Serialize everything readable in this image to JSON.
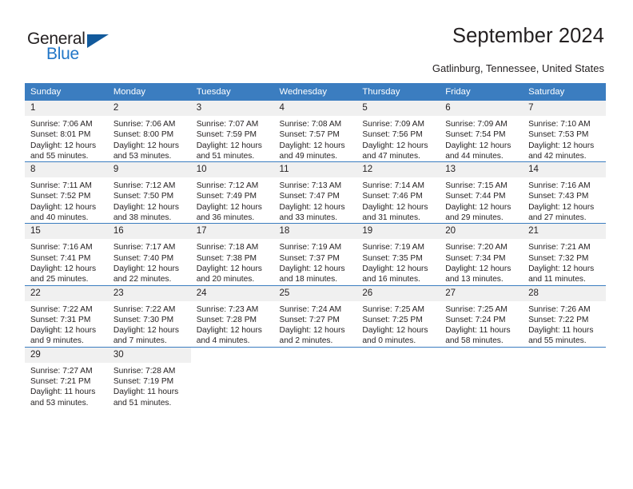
{
  "brand": {
    "name_dark": "General",
    "name_light": "Blue",
    "logo_icon": "triangle-logo-icon",
    "accent_color": "#125a9c",
    "light_accent_color": "#2176c7"
  },
  "header": {
    "title": "September 2024",
    "location": "Gatlinburg, Tennessee, United States"
  },
  "calendar": {
    "header_bg": "#3b7dc0",
    "daynum_bg": "#f0f0f0",
    "weekday_headers": [
      "Sunday",
      "Monday",
      "Tuesday",
      "Wednesday",
      "Thursday",
      "Friday",
      "Saturday"
    ],
    "weeks": [
      [
        {
          "day": "1",
          "sunrise": "Sunrise: 7:06 AM",
          "sunset": "Sunset: 8:01 PM",
          "daylight_1": "Daylight: 12 hours",
          "daylight_2": "and 55 minutes."
        },
        {
          "day": "2",
          "sunrise": "Sunrise: 7:06 AM",
          "sunset": "Sunset: 8:00 PM",
          "daylight_1": "Daylight: 12 hours",
          "daylight_2": "and 53 minutes."
        },
        {
          "day": "3",
          "sunrise": "Sunrise: 7:07 AM",
          "sunset": "Sunset: 7:59 PM",
          "daylight_1": "Daylight: 12 hours",
          "daylight_2": "and 51 minutes."
        },
        {
          "day": "4",
          "sunrise": "Sunrise: 7:08 AM",
          "sunset": "Sunset: 7:57 PM",
          "daylight_1": "Daylight: 12 hours",
          "daylight_2": "and 49 minutes."
        },
        {
          "day": "5",
          "sunrise": "Sunrise: 7:09 AM",
          "sunset": "Sunset: 7:56 PM",
          "daylight_1": "Daylight: 12 hours",
          "daylight_2": "and 47 minutes."
        },
        {
          "day": "6",
          "sunrise": "Sunrise: 7:09 AM",
          "sunset": "Sunset: 7:54 PM",
          "daylight_1": "Daylight: 12 hours",
          "daylight_2": "and 44 minutes."
        },
        {
          "day": "7",
          "sunrise": "Sunrise: 7:10 AM",
          "sunset": "Sunset: 7:53 PM",
          "daylight_1": "Daylight: 12 hours",
          "daylight_2": "and 42 minutes."
        }
      ],
      [
        {
          "day": "8",
          "sunrise": "Sunrise: 7:11 AM",
          "sunset": "Sunset: 7:52 PM",
          "daylight_1": "Daylight: 12 hours",
          "daylight_2": "and 40 minutes."
        },
        {
          "day": "9",
          "sunrise": "Sunrise: 7:12 AM",
          "sunset": "Sunset: 7:50 PM",
          "daylight_1": "Daylight: 12 hours",
          "daylight_2": "and 38 minutes."
        },
        {
          "day": "10",
          "sunrise": "Sunrise: 7:12 AM",
          "sunset": "Sunset: 7:49 PM",
          "daylight_1": "Daylight: 12 hours",
          "daylight_2": "and 36 minutes."
        },
        {
          "day": "11",
          "sunrise": "Sunrise: 7:13 AM",
          "sunset": "Sunset: 7:47 PM",
          "daylight_1": "Daylight: 12 hours",
          "daylight_2": "and 33 minutes."
        },
        {
          "day": "12",
          "sunrise": "Sunrise: 7:14 AM",
          "sunset": "Sunset: 7:46 PM",
          "daylight_1": "Daylight: 12 hours",
          "daylight_2": "and 31 minutes."
        },
        {
          "day": "13",
          "sunrise": "Sunrise: 7:15 AM",
          "sunset": "Sunset: 7:44 PM",
          "daylight_1": "Daylight: 12 hours",
          "daylight_2": "and 29 minutes."
        },
        {
          "day": "14",
          "sunrise": "Sunrise: 7:16 AM",
          "sunset": "Sunset: 7:43 PM",
          "daylight_1": "Daylight: 12 hours",
          "daylight_2": "and 27 minutes."
        }
      ],
      [
        {
          "day": "15",
          "sunrise": "Sunrise: 7:16 AM",
          "sunset": "Sunset: 7:41 PM",
          "daylight_1": "Daylight: 12 hours",
          "daylight_2": "and 25 minutes."
        },
        {
          "day": "16",
          "sunrise": "Sunrise: 7:17 AM",
          "sunset": "Sunset: 7:40 PM",
          "daylight_1": "Daylight: 12 hours",
          "daylight_2": "and 22 minutes."
        },
        {
          "day": "17",
          "sunrise": "Sunrise: 7:18 AM",
          "sunset": "Sunset: 7:38 PM",
          "daylight_1": "Daylight: 12 hours",
          "daylight_2": "and 20 minutes."
        },
        {
          "day": "18",
          "sunrise": "Sunrise: 7:19 AM",
          "sunset": "Sunset: 7:37 PM",
          "daylight_1": "Daylight: 12 hours",
          "daylight_2": "and 18 minutes."
        },
        {
          "day": "19",
          "sunrise": "Sunrise: 7:19 AM",
          "sunset": "Sunset: 7:35 PM",
          "daylight_1": "Daylight: 12 hours",
          "daylight_2": "and 16 minutes."
        },
        {
          "day": "20",
          "sunrise": "Sunrise: 7:20 AM",
          "sunset": "Sunset: 7:34 PM",
          "daylight_1": "Daylight: 12 hours",
          "daylight_2": "and 13 minutes."
        },
        {
          "day": "21",
          "sunrise": "Sunrise: 7:21 AM",
          "sunset": "Sunset: 7:32 PM",
          "daylight_1": "Daylight: 12 hours",
          "daylight_2": "and 11 minutes."
        }
      ],
      [
        {
          "day": "22",
          "sunrise": "Sunrise: 7:22 AM",
          "sunset": "Sunset: 7:31 PM",
          "daylight_1": "Daylight: 12 hours",
          "daylight_2": "and 9 minutes."
        },
        {
          "day": "23",
          "sunrise": "Sunrise: 7:22 AM",
          "sunset": "Sunset: 7:30 PM",
          "daylight_1": "Daylight: 12 hours",
          "daylight_2": "and 7 minutes."
        },
        {
          "day": "24",
          "sunrise": "Sunrise: 7:23 AM",
          "sunset": "Sunset: 7:28 PM",
          "daylight_1": "Daylight: 12 hours",
          "daylight_2": "and 4 minutes."
        },
        {
          "day": "25",
          "sunrise": "Sunrise: 7:24 AM",
          "sunset": "Sunset: 7:27 PM",
          "daylight_1": "Daylight: 12 hours",
          "daylight_2": "and 2 minutes."
        },
        {
          "day": "26",
          "sunrise": "Sunrise: 7:25 AM",
          "sunset": "Sunset: 7:25 PM",
          "daylight_1": "Daylight: 12 hours",
          "daylight_2": "and 0 minutes."
        },
        {
          "day": "27",
          "sunrise": "Sunrise: 7:25 AM",
          "sunset": "Sunset: 7:24 PM",
          "daylight_1": "Daylight: 11 hours",
          "daylight_2": "and 58 minutes."
        },
        {
          "day": "28",
          "sunrise": "Sunrise: 7:26 AM",
          "sunset": "Sunset: 7:22 PM",
          "daylight_1": "Daylight: 11 hours",
          "daylight_2": "and 55 minutes."
        }
      ],
      [
        {
          "day": "29",
          "sunrise": "Sunrise: 7:27 AM",
          "sunset": "Sunset: 7:21 PM",
          "daylight_1": "Daylight: 11 hours",
          "daylight_2": "and 53 minutes."
        },
        {
          "day": "30",
          "sunrise": "Sunrise: 7:28 AM",
          "sunset": "Sunset: 7:19 PM",
          "daylight_1": "Daylight: 11 hours",
          "daylight_2": "and 51 minutes."
        },
        {
          "day": "",
          "sunrise": "",
          "sunset": "",
          "daylight_1": "",
          "daylight_2": ""
        },
        {
          "day": "",
          "sunrise": "",
          "sunset": "",
          "daylight_1": "",
          "daylight_2": ""
        },
        {
          "day": "",
          "sunrise": "",
          "sunset": "",
          "daylight_1": "",
          "daylight_2": ""
        },
        {
          "day": "",
          "sunrise": "",
          "sunset": "",
          "daylight_1": "",
          "daylight_2": ""
        },
        {
          "day": "",
          "sunrise": "",
          "sunset": "",
          "daylight_1": "",
          "daylight_2": ""
        }
      ]
    ]
  }
}
